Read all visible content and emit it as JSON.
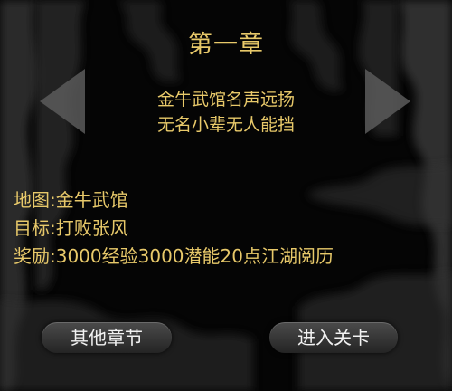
{
  "chapter": {
    "title": "第一章",
    "story_lines": [
      "金牛武馆名声远扬",
      "无名小辈无人能挡"
    ]
  },
  "info": {
    "map": "地图:金牛武馆",
    "goal": "目标:打败张风",
    "reward": "奖励:3000经验3000潜能20点江湖阅历"
  },
  "buttons": {
    "other_chapters": "其他章节",
    "enter_level": "进入关卡"
  },
  "colors": {
    "text_gold": "#e8c96a",
    "background": "#050505",
    "button_text": "#f2f2f2"
  },
  "icons": {
    "prev": "triangle-left-icon",
    "next": "triangle-right-icon"
  }
}
